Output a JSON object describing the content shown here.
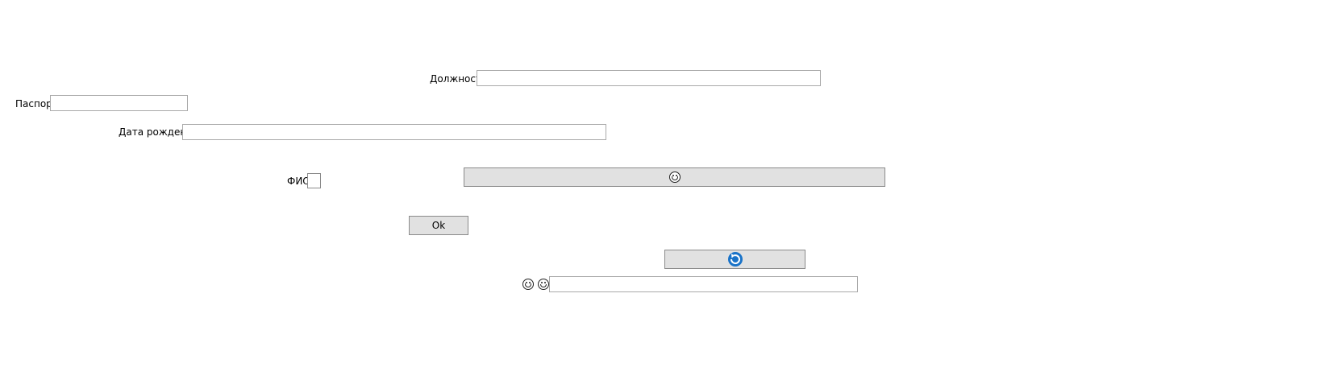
{
  "form": {
    "position_label": "Должность",
    "position_value": "",
    "passport_label": "Паспорт",
    "passport_value": "",
    "birthdate_label": "Дата рождения",
    "birthdate_value": "",
    "fio_label": "ФИО",
    "fio_checked": false,
    "ok_label": "Ok",
    "bottom_value": ""
  },
  "icons": {
    "wide_button_icon": "laughing-face-icon",
    "small_button_icon": "blue-refresh-icon",
    "bottom_icon_1": "laughing-face-icon",
    "bottom_icon_2": "grinning-face-icon"
  },
  "colors": {
    "button_bg": "#e1e1e1",
    "field_border": "#a9a9a9",
    "refresh_icon": "#1a73c8"
  }
}
